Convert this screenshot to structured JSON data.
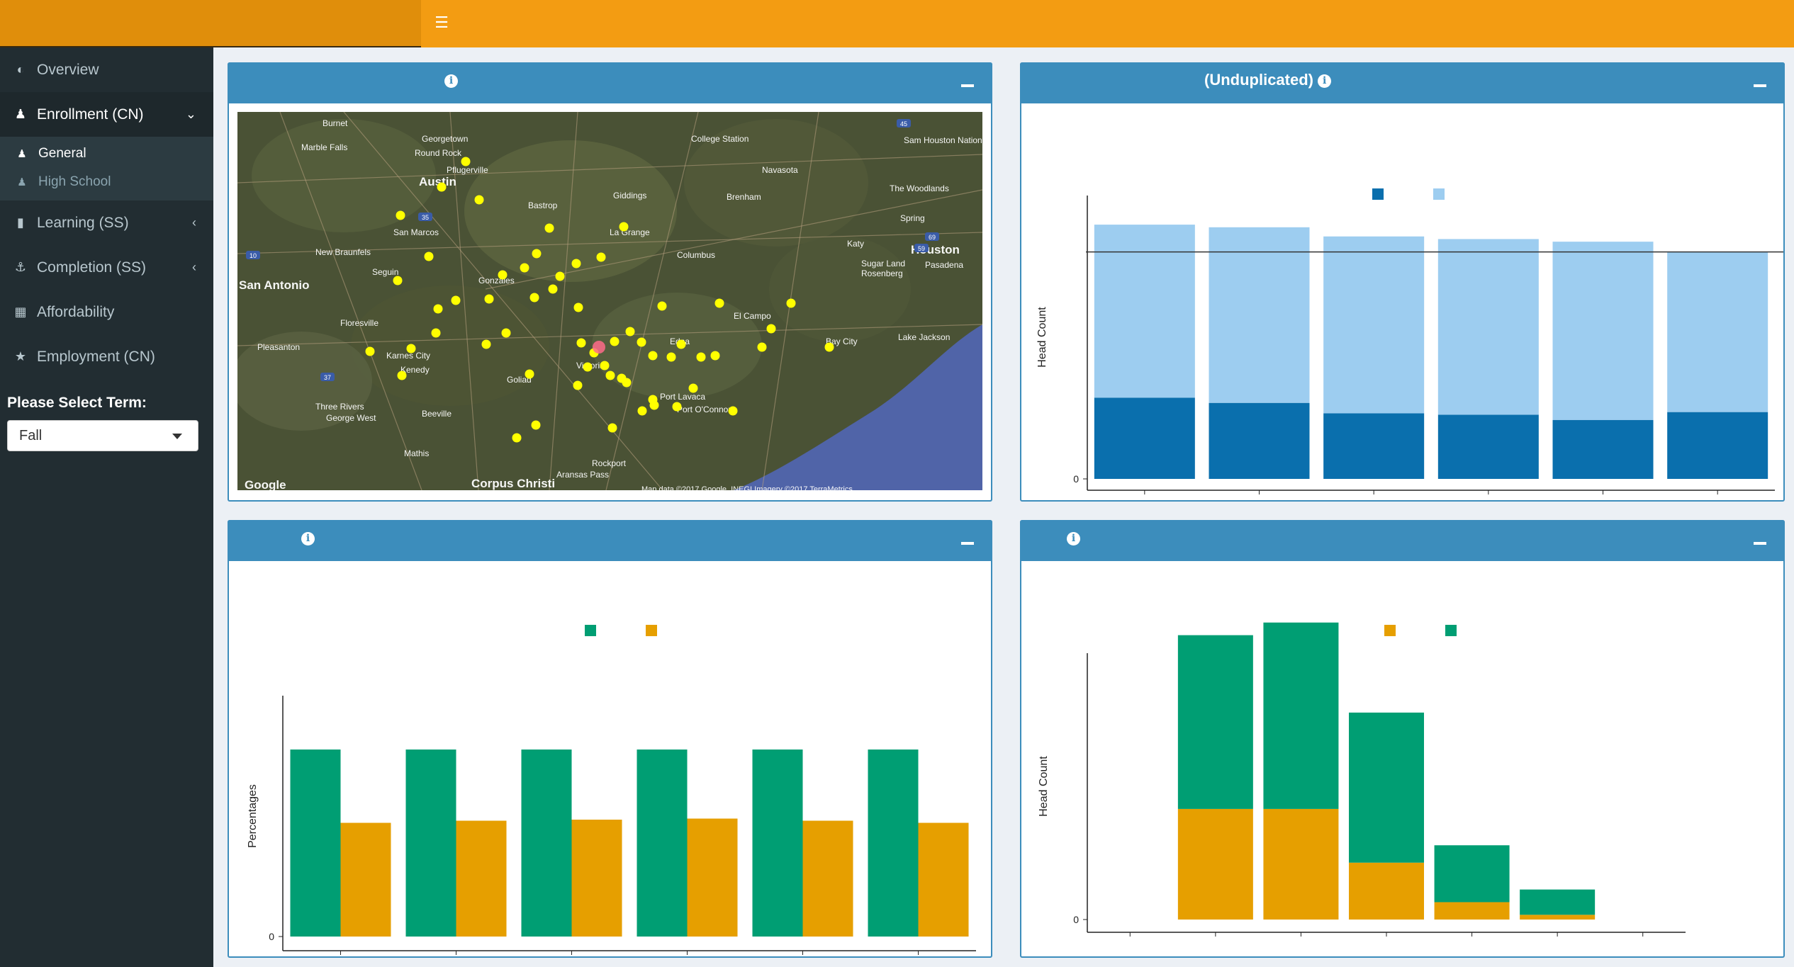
{
  "sidebar": {
    "items": [
      {
        "label": "Overview",
        "icon": "dashboard-icon"
      },
      {
        "label": "Enrollment (CN)",
        "icon": "graduate-icon",
        "expanded": true,
        "children": [
          {
            "label": "General",
            "icon": "graduate-icon",
            "active": true
          },
          {
            "label": "High School",
            "icon": "graduate-icon"
          }
        ]
      },
      {
        "label": "Learning (SS)",
        "icon": "book-icon"
      },
      {
        "label": "Completion (SS)",
        "icon": "anchor-icon"
      },
      {
        "label": "Affordability",
        "icon": "map-icon"
      },
      {
        "label": "Employment (CN)",
        "icon": "trophy-icon"
      }
    ],
    "term_label": "Please Select Term:",
    "term_value": "Fall"
  },
  "boxes": {
    "map": {
      "title": ""
    },
    "unduplicated": {
      "title": "(Unduplicated)"
    },
    "percentages": {
      "title": ""
    },
    "headcount": {
      "title": ""
    }
  },
  "map_data": {
    "labels": [
      "Burnet",
      "Marble Falls",
      "Georgetown",
      "Round Rock",
      "Pflugerville",
      "Austin",
      "College Station",
      "Navasota",
      "Giddings",
      "Brenham",
      "Bastrop",
      "Sam Houston National Forest",
      "The Woodlands",
      "Spring",
      "San Marcos",
      "New Braunfels",
      "Seguin",
      "Gonzales",
      "La Grange",
      "Columbus",
      "Katy",
      "Houston",
      "Sugar Land",
      "Rosenberg",
      "San Antonio",
      "Pasadena",
      "Floresville",
      "Pleasanton",
      "Karnes City",
      "Kenedy",
      "El Campo",
      "Lake Jackson",
      "Edna",
      "Bay City",
      "Goliad",
      "Victoria",
      "Three Rivers",
      "George West",
      "Beeville",
      "Port Lavaca",
      "Port O'Connor",
      "Mathis",
      "Rockport",
      "Aransas Pass",
      "Corpus Christi",
      "Google",
      "Map data ©2017 Google, INEGI Imagery ©2017 TerraMetrics"
    ],
    "highways": [
      "35",
      "10",
      "45",
      "37",
      "59",
      "69"
    ]
  },
  "colors": {
    "header_orange": "#f39c12",
    "box_blue": "#3c8dbc",
    "dark_blue": "#0a6fad",
    "light_blue": "#9dcdf0",
    "green": "#009e73",
    "orange": "#e69f00",
    "sidebar": "#222d32"
  },
  "chart_data": [
    {
      "type": "bar",
      "stacked": true,
      "ylabel": "Head Count",
      "yticks": [
        "0"
      ],
      "ylim": [
        0,
        1.0
      ],
      "reference_line": 0.866,
      "series": [
        {
          "values": [
            0.31,
            0.29,
            0.25,
            0.245,
            0.225,
            0.255
          ],
          "color": "#0a6fad"
        },
        {
          "values": [
            0.66,
            0.67,
            0.675,
            0.67,
            0.68,
            0.61
          ],
          "color": "#9dcdf0"
        }
      ],
      "categories_count": 6,
      "legend_placement": "top"
    },
    {
      "type": "bar",
      "grouped": true,
      "ylabel": "Percentages",
      "yticks": [
        "0"
      ],
      "ylim": [
        0,
        1.0
      ],
      "series": [
        {
          "values": [
            0.88,
            0.88,
            0.88,
            0.88,
            0.88,
            0.88
          ],
          "color": "#009e73"
        },
        {
          "values": [
            0.535,
            0.545,
            0.55,
            0.555,
            0.545,
            0.535
          ],
          "color": "#e69f00"
        }
      ],
      "categories_count": 6,
      "legend_placement": "top"
    },
    {
      "type": "bar",
      "stacked": true,
      "ylabel": "Head Count",
      "yticks": [
        "0"
      ],
      "ylim": [
        0,
        1.0
      ],
      "series": [
        {
          "values": [
            0,
            0.35,
            0.35,
            0.18,
            0.055,
            0.015,
            0
          ],
          "color": "#e69f00"
        },
        {
          "values": [
            0,
            0.55,
            0.59,
            0.475,
            0.18,
            0.08,
            0
          ],
          "color": "#009e73"
        }
      ],
      "categories_count": 7,
      "legend_placement": "top"
    }
  ]
}
